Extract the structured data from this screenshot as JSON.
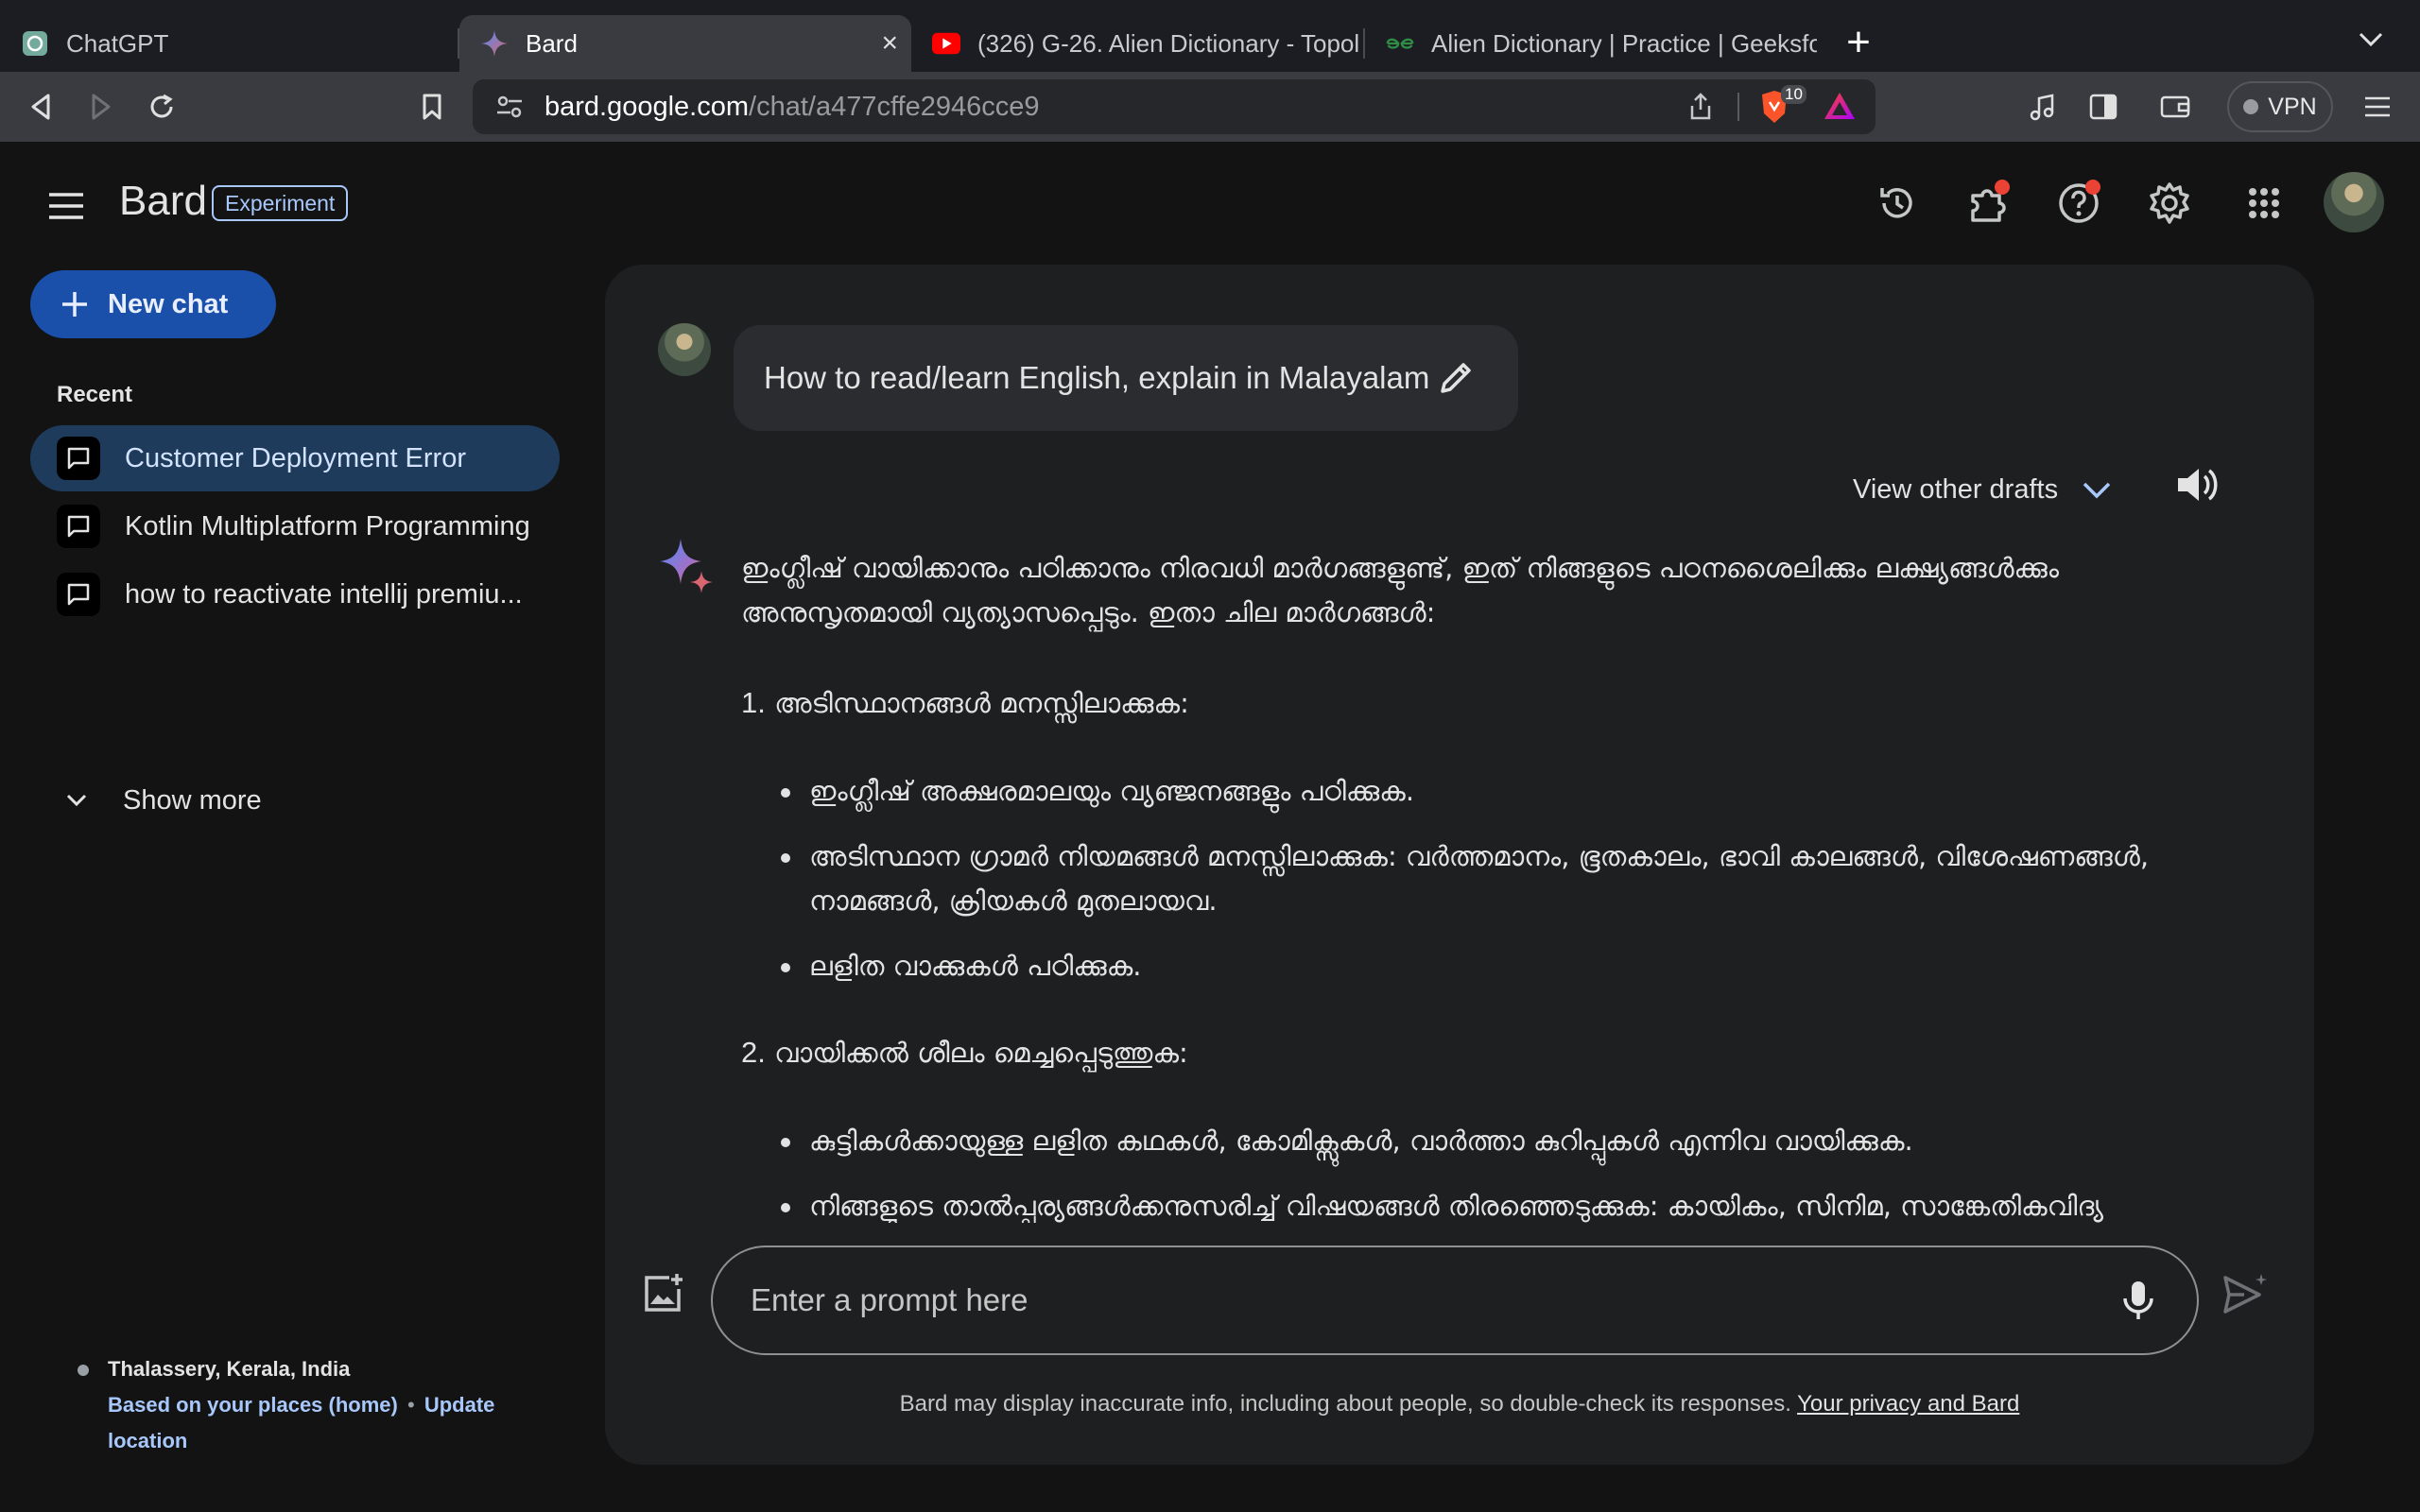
{
  "browser": {
    "tabs": [
      {
        "title": "ChatGPT",
        "favicon": "chatgpt-icon"
      },
      {
        "title": "Bard",
        "favicon": "bard-sparkle-icon",
        "active": true
      },
      {
        "title": "(326) G-26. Alien Dictionary - Topol",
        "favicon": "youtube-icon"
      },
      {
        "title": "Alien Dictionary | Practice | Geeksfo",
        "favicon": "geeksforgeeks-icon"
      }
    ],
    "url": {
      "host": "bard.google.com",
      "path": "/chat/a477cffe2946cce9"
    },
    "brave_badge_count": "10",
    "vpn_label": "VPN"
  },
  "app": {
    "brand": "Bard",
    "badge": "Experiment",
    "new_chat_label": "New chat",
    "recent_label": "Recent",
    "recent_items": [
      {
        "label": "Customer Deployment Error",
        "selected": true
      },
      {
        "label": "Kotlin Multiplatform Programming"
      },
      {
        "label": "how to reactivate intellij premiu..."
      }
    ],
    "show_more_label": "Show more",
    "location": {
      "place": "Thalassery, Kerala, India",
      "based_on": "Based on your places (home)",
      "separator": "•",
      "update": "Update",
      "update2": "location"
    }
  },
  "conversation": {
    "question": "How to read/learn English, explain in Malayalam",
    "view_drafts_label": "View other drafts",
    "answer": {
      "intro": "ഇംഗ്ലീഷ് വായിക്കാനും പഠിക്കാനും നിരവധി മാർഗങ്ങളുണ്ട്, ഇത് നിങ്ങളുടെ പഠനശൈലിക്കും ലക്ഷ്യങ്ങൾക്കും അനുസൃതമായി വ്യത്യാസപ്പെടും. ഇതാ ചില മാർഗങ്ങൾ:",
      "sections": [
        {
          "num": "1.",
          "heading": "അടിസ്ഥാനങ്ങൾ മനസ്സിലാക്കുക:",
          "bullets": [
            "ഇംഗ്ലീഷ് അക്ഷരമാലയും വ്യഞ്ജനങ്ങളും പഠിക്കുക.",
            "അടിസ്ഥാന ഗ്രാമർ നിയമങ്ങൾ മനസ്സിലാക്കുക: വർത്തമാനം, ഭൂതകാലം, ഭാവി കാലങ്ങൾ, വിശേഷണങ്ങൾ, നാമങ്ങൾ, ക്രിയകൾ മുതലായവ.",
            "ലളിത വാക്കുകൾ പഠിക്കുക."
          ]
        },
        {
          "num": "2.",
          "heading": "വായിക്കൽ ശീലം മെച്ചപ്പെടുത്തുക:",
          "bullets": [
            "കുട്ടികൾക്കായുള്ള ലളിത കഥകൾ, കോമിക്സുകൾ, വാർത്താ കുറിപ്പുകൾ എന്നിവ വായിക്കുക.",
            "നിങ്ങളുടെ താൽപ്പര്യങ്ങൾക്കനുസരിച്ച് വിഷയങ്ങൾ തിരഞ്ഞെടുക്കുക: കായികം, സിനിമ, സാങ്കേതികവിദ്യ"
          ]
        }
      ]
    }
  },
  "input": {
    "placeholder": "Enter a prompt here",
    "disclaimer": "Bard may display inaccurate info, including about people, so double-check its responses.",
    "privacy_link": "Your privacy and Bard"
  },
  "colors": {
    "accent": "#a8c7fa",
    "new_chat_bg": "#1a4faa",
    "selected_item_bg": "#1f3b5c",
    "notification": "#ea4335"
  }
}
